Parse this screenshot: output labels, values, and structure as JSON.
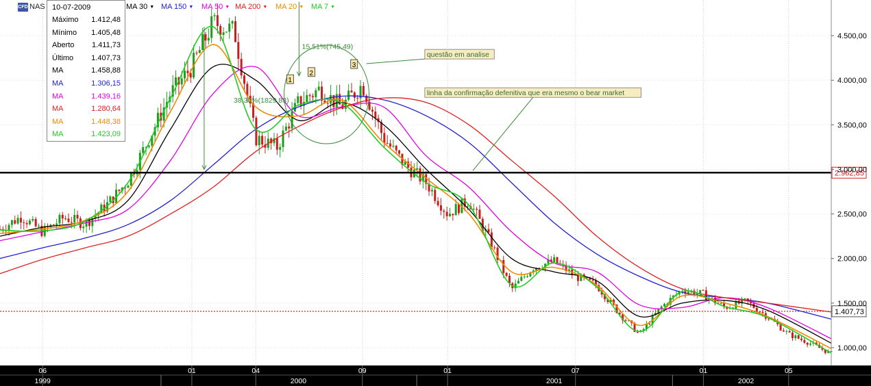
{
  "toolbar": {
    "logo": "CFD",
    "symbol": "NAS",
    "ma_buttons": [
      {
        "label": "MA 30",
        "color": "#000000"
      },
      {
        "label": "MA 150",
        "color": "#2020d0"
      },
      {
        "label": "MA 50",
        "color": "#e000e0"
      },
      {
        "label": "MA 200",
        "color": "#e02020"
      },
      {
        "label": "MA 20",
        "color": "#f08a00"
      },
      {
        "label": "MA 7",
        "color": "#22cc22"
      }
    ]
  },
  "info_panel": {
    "date": "10-07-2009",
    "rows": [
      {
        "label": "Máximo",
        "value": "1.412,48",
        "color": "#000000"
      },
      {
        "label": "Mínimo",
        "value": "1.405,48",
        "color": "#000000"
      },
      {
        "label": "Aberto",
        "value": "1.411,73",
        "color": "#000000"
      },
      {
        "label": "Último",
        "value": "1.407,73",
        "color": "#000000"
      },
      {
        "label": "MA",
        "value": "1.458,88",
        "color": "#000000"
      },
      {
        "label": "MA",
        "value": "1.306,15",
        "color": "#2020d0"
      },
      {
        "label": "MA",
        "value": "1.439,16",
        "color": "#e000e0"
      },
      {
        "label": "MA",
        "value": "1.280,64",
        "color": "#e02020"
      },
      {
        "label": "MA",
        "value": "1.448,38",
        "color": "#f08a00"
      },
      {
        "label": "MA",
        "value": "1.423,09",
        "color": "#22cc22"
      }
    ]
  },
  "chart_data": {
    "type": "line",
    "subtype": "candlestick-with-moving-averages",
    "x_range": [
      "1999-04",
      "2002-07"
    ],
    "y_range": [
      800,
      4900
    ],
    "y_ticks": [
      {
        "value": 1000,
        "label": "1.000,00"
      },
      {
        "value": 1500,
        "label": "1.500,00"
      },
      {
        "value": 2000,
        "label": "2.000,00"
      },
      {
        "value": 2500,
        "label": "2.500,00"
      },
      {
        "value": 3000,
        "label": "3.000,00"
      },
      {
        "value": 3500,
        "label": "3.500,00"
      },
      {
        "value": 4000,
        "label": "4.000,00"
      },
      {
        "value": 4500,
        "label": "4.500,00"
      }
    ],
    "x_ticks_top": [
      {
        "date": "1999-06",
        "label": "06"
      },
      {
        "date": "2000-01",
        "label": "01"
      },
      {
        "date": "2000-04",
        "label": "04"
      },
      {
        "date": "2000-09",
        "label": "09"
      },
      {
        "date": "2001-01",
        "label": "01"
      },
      {
        "date": "2001-07",
        "label": "07"
      },
      {
        "date": "2002-01",
        "label": "01"
      },
      {
        "date": "2002-05",
        "label": "05"
      }
    ],
    "x_ticks_year": [
      {
        "date": "1999-06",
        "label": "1999"
      },
      {
        "date": "2000-06",
        "label": "2000"
      },
      {
        "date": "2001-06",
        "label": "2001"
      },
      {
        "date": "2002-03",
        "label": "2002"
      }
    ],
    "price_path": [
      {
        "x": "1999-04",
        "y": 2330
      },
      {
        "x": "1999-05",
        "y": 2470
      },
      {
        "x": "1999-06",
        "y": 2300
      },
      {
        "x": "1999-07",
        "y": 2460
      },
      {
        "x": "1999-08",
        "y": 2390
      },
      {
        "x": "1999-09",
        "y": 2600
      },
      {
        "x": "1999-10",
        "y": 2870
      },
      {
        "x": "1999-11",
        "y": 3350
      },
      {
        "x": "1999-12",
        "y": 3850
      },
      {
        "x": "2000-01",
        "y": 4150
      },
      {
        "x": "2000-02",
        "y": 4650
      },
      {
        "x": "2000-03",
        "y": 4550
      },
      {
        "x": "2000-04",
        "y": 3350
      },
      {
        "x": "2000-05",
        "y": 3250
      },
      {
        "x": "2000-06",
        "y": 3750
      },
      {
        "x": "2000-07",
        "y": 3900
      },
      {
        "x": "2000-08",
        "y": 3700
      },
      {
        "x": "2000-09",
        "y": 3950
      },
      {
        "x": "2000-10",
        "y": 3350
      },
      {
        "x": "2000-11",
        "y": 3050
      },
      {
        "x": "2000-12",
        "y": 2850
      },
      {
        "x": "2001-01",
        "y": 2500
      },
      {
        "x": "2001-02",
        "y": 2650
      },
      {
        "x": "2001-03",
        "y": 2200
      },
      {
        "x": "2001-04",
        "y": 1650
      },
      {
        "x": "2001-05",
        "y": 1900
      },
      {
        "x": "2001-06",
        "y": 1970
      },
      {
        "x": "2001-07",
        "y": 1800
      },
      {
        "x": "2001-08",
        "y": 1700
      },
      {
        "x": "2001-09",
        "y": 1400
      },
      {
        "x": "2001-10",
        "y": 1150
      },
      {
        "x": "2001-11",
        "y": 1450
      },
      {
        "x": "2001-12",
        "y": 1650
      },
      {
        "x": "2002-01",
        "y": 1600
      },
      {
        "x": "2002-02",
        "y": 1450
      },
      {
        "x": "2002-03",
        "y": 1520
      },
      {
        "x": "2002-04",
        "y": 1350
      },
      {
        "x": "2002-05",
        "y": 1150
      },
      {
        "x": "2002-06",
        "y": 1050
      },
      {
        "x": "2002-07",
        "y": 930
      }
    ],
    "series": [
      {
        "name": "MA 30",
        "color": "#000000",
        "values": [
          {
            "x": "1999-04",
            "y": 2250
          },
          {
            "x": "1999-06",
            "y": 2350
          },
          {
            "x": "1999-08",
            "y": 2420
          },
          {
            "x": "1999-10",
            "y": 2650
          },
          {
            "x": "1999-12",
            "y": 3450
          },
          {
            "x": "2000-02",
            "y": 4150
          },
          {
            "x": "2000-04",
            "y": 4000
          },
          {
            "x": "2000-06",
            "y": 3550
          },
          {
            "x": "2000-08",
            "y": 3750
          },
          {
            "x": "2000-10",
            "y": 3500
          },
          {
            "x": "2000-12",
            "y": 3000
          },
          {
            "x": "2001-02",
            "y": 2550
          },
          {
            "x": "2001-04",
            "y": 2000
          },
          {
            "x": "2001-06",
            "y": 1850
          },
          {
            "x": "2001-08",
            "y": 1750
          },
          {
            "x": "2001-10",
            "y": 1350
          },
          {
            "x": "2001-12",
            "y": 1500
          },
          {
            "x": "2002-02",
            "y": 1530
          },
          {
            "x": "2002-04",
            "y": 1420
          },
          {
            "x": "2002-07",
            "y": 1050
          }
        ]
      },
      {
        "name": "MA 150",
        "color": "#2020d0",
        "values": [
          {
            "x": "1999-04",
            "y": 2000
          },
          {
            "x": "1999-06",
            "y": 2120
          },
          {
            "x": "1999-08",
            "y": 2230
          },
          {
            "x": "1999-10",
            "y": 2380
          },
          {
            "x": "1999-12",
            "y": 2650
          },
          {
            "x": "2000-02",
            "y": 3050
          },
          {
            "x": "2000-04",
            "y": 3450
          },
          {
            "x": "2000-06",
            "y": 3700
          },
          {
            "x": "2000-08",
            "y": 3820
          },
          {
            "x": "2000-10",
            "y": 3780
          },
          {
            "x": "2000-12",
            "y": 3600
          },
          {
            "x": "2001-02",
            "y": 3300
          },
          {
            "x": "2001-04",
            "y": 2850
          },
          {
            "x": "2001-06",
            "y": 2400
          },
          {
            "x": "2001-08",
            "y": 2050
          },
          {
            "x": "2001-10",
            "y": 1800
          },
          {
            "x": "2001-12",
            "y": 1620
          },
          {
            "x": "2002-02",
            "y": 1560
          },
          {
            "x": "2002-04",
            "y": 1500
          },
          {
            "x": "2002-07",
            "y": 1320
          }
        ]
      },
      {
        "name": "MA 50",
        "color": "#e000e0",
        "values": [
          {
            "x": "1999-04",
            "y": 2200
          },
          {
            "x": "1999-06",
            "y": 2300
          },
          {
            "x": "1999-08",
            "y": 2400
          },
          {
            "x": "1999-10",
            "y": 2550
          },
          {
            "x": "1999-12",
            "y": 3100
          },
          {
            "x": "2000-02",
            "y": 3850
          },
          {
            "x": "2000-04",
            "y": 4150
          },
          {
            "x": "2000-06",
            "y": 3600
          },
          {
            "x": "2000-08",
            "y": 3700
          },
          {
            "x": "2000-10",
            "y": 3700
          },
          {
            "x": "2000-12",
            "y": 3150
          },
          {
            "x": "2001-02",
            "y": 2800
          },
          {
            "x": "2001-04",
            "y": 2300
          },
          {
            "x": "2001-06",
            "y": 1950
          },
          {
            "x": "2001-08",
            "y": 1850
          },
          {
            "x": "2001-10",
            "y": 1480
          },
          {
            "x": "2001-12",
            "y": 1450
          },
          {
            "x": "2002-02",
            "y": 1560
          },
          {
            "x": "2002-04",
            "y": 1450
          },
          {
            "x": "2002-07",
            "y": 1100
          }
        ]
      },
      {
        "name": "MA 200",
        "color": "#e02020",
        "values": [
          {
            "x": "1999-04",
            "y": 1830
          },
          {
            "x": "1999-06",
            "y": 1990
          },
          {
            "x": "1999-08",
            "y": 2120
          },
          {
            "x": "1999-10",
            "y": 2250
          },
          {
            "x": "1999-12",
            "y": 2500
          },
          {
            "x": "2000-02",
            "y": 2800
          },
          {
            "x": "2000-04",
            "y": 3200
          },
          {
            "x": "2000-06",
            "y": 3480
          },
          {
            "x": "2000-08",
            "y": 3690
          },
          {
            "x": "2000-10",
            "y": 3800
          },
          {
            "x": "2000-12",
            "y": 3750
          },
          {
            "x": "2001-02",
            "y": 3500
          },
          {
            "x": "2001-04",
            "y": 3100
          },
          {
            "x": "2001-06",
            "y": 2700
          },
          {
            "x": "2001-08",
            "y": 2250
          },
          {
            "x": "2001-10",
            "y": 1900
          },
          {
            "x": "2001-12",
            "y": 1660
          },
          {
            "x": "2002-02",
            "y": 1560
          },
          {
            "x": "2002-04",
            "y": 1500
          },
          {
            "x": "2002-07",
            "y": 1400
          }
        ]
      },
      {
        "name": "MA 20",
        "color": "#f08a00",
        "values": [
          {
            "x": "1999-04",
            "y": 2280
          },
          {
            "x": "1999-06",
            "y": 2330
          },
          {
            "x": "1999-08",
            "y": 2430
          },
          {
            "x": "1999-10",
            "y": 2750
          },
          {
            "x": "1999-12",
            "y": 3650
          },
          {
            "x": "2000-02",
            "y": 4400
          },
          {
            "x": "2000-04",
            "y": 3700
          },
          {
            "x": "2000-06",
            "y": 3600
          },
          {
            "x": "2000-08",
            "y": 3780
          },
          {
            "x": "2000-10",
            "y": 3300
          },
          {
            "x": "2000-12",
            "y": 2900
          },
          {
            "x": "2001-02",
            "y": 2500
          },
          {
            "x": "2001-04",
            "y": 1850
          },
          {
            "x": "2001-06",
            "y": 1900
          },
          {
            "x": "2001-08",
            "y": 1700
          },
          {
            "x": "2001-10",
            "y": 1250
          },
          {
            "x": "2001-12",
            "y": 1580
          },
          {
            "x": "2002-02",
            "y": 1500
          },
          {
            "x": "2002-04",
            "y": 1350
          },
          {
            "x": "2002-07",
            "y": 990
          }
        ]
      },
      {
        "name": "MA 7",
        "color": "#22cc22",
        "values": [
          {
            "x": "1999-04",
            "y": 2320
          },
          {
            "x": "1999-06",
            "y": 2310
          },
          {
            "x": "1999-08",
            "y": 2420
          },
          {
            "x": "1999-10",
            "y": 2850
          },
          {
            "x": "1999-12",
            "y": 3800
          },
          {
            "x": "2000-02",
            "y": 4600
          },
          {
            "x": "2000-04",
            "y": 3450
          },
          {
            "x": "2000-06",
            "y": 3720
          },
          {
            "x": "2000-08",
            "y": 3750
          },
          {
            "x": "2000-10",
            "y": 3250
          },
          {
            "x": "2000-12",
            "y": 2850
          },
          {
            "x": "2001-02",
            "y": 2600
          },
          {
            "x": "2001-04",
            "y": 1700
          },
          {
            "x": "2001-06",
            "y": 1950
          },
          {
            "x": "2001-08",
            "y": 1680
          },
          {
            "x": "2001-10",
            "y": 1180
          },
          {
            "x": "2001-12",
            "y": 1630
          },
          {
            "x": "2002-02",
            "y": 1460
          },
          {
            "x": "2002-04",
            "y": 1340
          },
          {
            "x": "2002-07",
            "y": 940
          }
        ]
      }
    ],
    "horizontal_lines": [
      {
        "value": 2962.85,
        "label": "2.962,85",
        "style": "solid",
        "color": "#000000"
      },
      {
        "value": 1407.73,
        "label": "1.407,73",
        "style": "dotted",
        "color": "#e02020"
      }
    ],
    "annotations": {
      "peak_labels": [
        {
          "label": "1",
          "x": "2000-06",
          "y": 4000
        },
        {
          "label": "2",
          "x": "2000-07",
          "y": 4080
        },
        {
          "label": "3",
          "x": "2000-09",
          "y": 4170
        }
      ],
      "drop_measure": {
        "text": "38,30%(1829,83)",
        "x": "2000-02",
        "y": 3780
      },
      "rise_measure": {
        "text": "15,51%(745,49)",
        "x": "2000-07",
        "y": 4380
      },
      "callout_analysis": {
        "text": "questão em analise",
        "x": "2000-10",
        "y": 4300
      },
      "callout_confirmation": {
        "text": "linha da confirmação defenitiva que era mesmo o bear market",
        "x": "2000-10",
        "y": 3900
      }
    }
  }
}
